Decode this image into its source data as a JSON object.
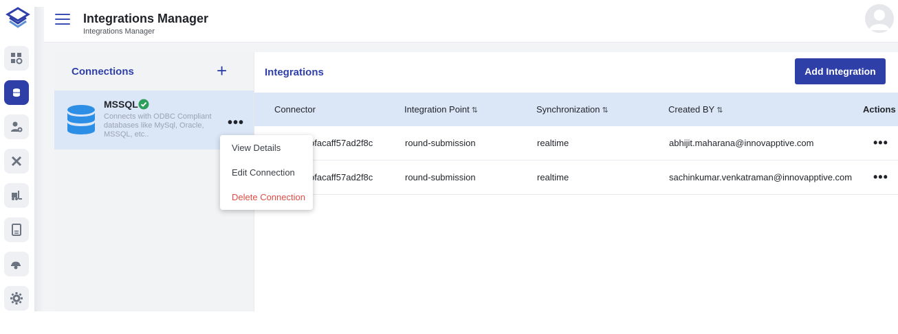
{
  "header": {
    "title": "Integrations Manager",
    "subtitle": "Integrations Manager"
  },
  "sidebar": {
    "items": [
      {
        "icon": "dashboard-settings-icon",
        "active": false
      },
      {
        "icon": "database-icon",
        "active": true
      },
      {
        "icon": "user-settings-icon",
        "active": false
      },
      {
        "icon": "tools-icon",
        "active": false
      },
      {
        "icon": "forklift-icon",
        "active": false
      },
      {
        "icon": "document-icon",
        "active": false
      },
      {
        "icon": "worker-helmet-icon",
        "active": false
      },
      {
        "icon": "gear-icon",
        "active": false
      }
    ]
  },
  "connections": {
    "title": "Connections",
    "add_icon": "+",
    "card": {
      "name": "MSSQL",
      "description": "Connects with ODBC Compliant databases like MySql, Oracle, MSSQL, etc..",
      "more": "•••"
    },
    "menu": {
      "view": "View Details",
      "edit": "Edit Connection",
      "delete": "Delete Connection"
    }
  },
  "integrations": {
    "title": "Integrations",
    "add_button": "Add Integration",
    "columns": {
      "connector": "Connector",
      "integration_point": "Integration Point",
      "synchronization": "Synchronization",
      "created_by": "Created BY",
      "actions": "Actions"
    },
    "sort_icon": "⇅",
    "rows": [
      {
        "connector": "ofacaff57ad2f8c",
        "integration_point": "round-submission",
        "synchronization": "realtime",
        "created_by": "abhijit.maharana@innovapptive.com",
        "more": "•••"
      },
      {
        "connector": "ofacaff57ad2f8c",
        "integration_point": "round-submission",
        "synchronization": "realtime",
        "created_by": "sachinkumar.venkatraman@innovapptive.com",
        "more": "•••"
      }
    ]
  },
  "colors": {
    "accent": "#2f3fa8",
    "selected_card": "#dbe6f7",
    "danger": "#e04b44",
    "verified": "#2e9e5b"
  }
}
